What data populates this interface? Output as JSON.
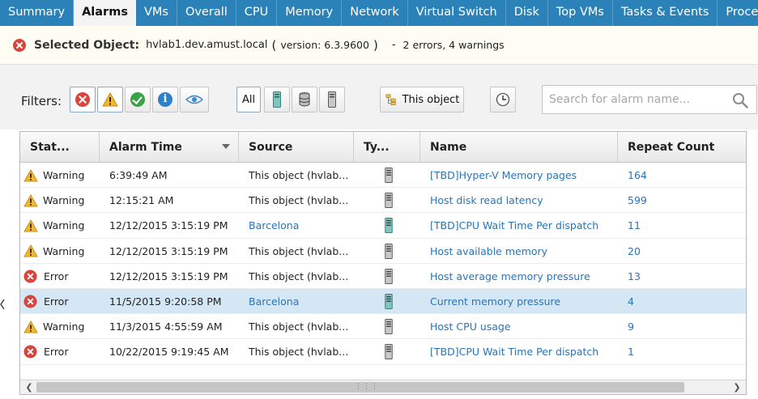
{
  "tabs": [
    "Summary",
    "Alarms",
    "VMs",
    "Overall",
    "CPU",
    "Memory",
    "Network",
    "Virtual Switch",
    "Disk",
    "Top VMs",
    "Tasks & Events",
    "Processes"
  ],
  "active_tab": "Alarms",
  "selected": {
    "label": "Selected Object:",
    "host": "hvlab1.dev.amust.local",
    "open_paren": "(",
    "version": "version: 6.3.9600",
    "close_paren": ")",
    "dash": "-",
    "summary": "2 errors, 4 warnings"
  },
  "filters": {
    "label": "Filters:",
    "all_label": "All",
    "this_object_label": "This object"
  },
  "search": {
    "placeholder": "Search for alarm name..."
  },
  "table": {
    "columns": [
      "Stat...",
      "Alarm Time",
      "Source",
      "Ty...",
      "Name",
      "Repeat Count"
    ],
    "rows": [
      {
        "status": "Warning",
        "status_icon": "warning-icon",
        "time": "6:39:49 AM",
        "source": "This object (hvlab...",
        "source_link": false,
        "type_icon": "host-icon",
        "name": "[TBD]Hyper-V Memory pages",
        "count": "164",
        "selected": false
      },
      {
        "status": "Warning",
        "status_icon": "warning-icon",
        "time": "12:15:21 AM",
        "source": "This object (hvlab...",
        "source_link": false,
        "type_icon": "host-icon",
        "name": "Host disk read latency",
        "count": "599",
        "selected": false
      },
      {
        "status": "Warning",
        "status_icon": "warning-icon",
        "time": "12/12/2015 3:15:19 PM",
        "source": "Barcelona",
        "source_link": true,
        "type_icon": "vm-icon",
        "name": "[TBD]CPU Wait Time Per dispatch",
        "count": "11",
        "selected": false
      },
      {
        "status": "Warning",
        "status_icon": "warning-icon",
        "time": "12/12/2015 3:15:19 PM",
        "source": "This object (hvlab...",
        "source_link": false,
        "type_icon": "host-icon",
        "name": "Host available memory",
        "count": "20",
        "selected": false
      },
      {
        "status": "Error",
        "status_icon": "error-icon",
        "time": "12/12/2015 3:15:19 PM",
        "source": "This object (hvlab...",
        "source_link": false,
        "type_icon": "host-icon",
        "name": "Host average memory pressure",
        "count": "13",
        "selected": false
      },
      {
        "status": "Error",
        "status_icon": "error-icon",
        "time": "11/5/2015 9:20:58 PM",
        "source": "Barcelona",
        "source_link": true,
        "type_icon": "vm-icon",
        "name": "Current memory pressure",
        "count": "4",
        "selected": true
      },
      {
        "status": "Warning",
        "status_icon": "warning-icon",
        "time": "11/3/2015 4:55:59 AM",
        "source": "This object (hvlab...",
        "source_link": false,
        "type_icon": "host-icon",
        "name": "Host CPU usage",
        "count": "9",
        "selected": false
      },
      {
        "status": "Error",
        "status_icon": "error-icon",
        "time": "10/22/2015 9:19:45 AM",
        "source": "This object (hvlab...",
        "source_link": false,
        "type_icon": "host-icon",
        "name": "[TBD]CPU Wait Time Per dispatch",
        "count": "1",
        "selected": false
      }
    ]
  },
  "colors": {
    "tab_bar": "#2b82b8",
    "error": "#d9443c",
    "warning": "#f2b72a",
    "ok": "#3aa347",
    "info": "#2f80c8",
    "link": "#2a74b8",
    "selected_row": "#d5e7f5"
  }
}
